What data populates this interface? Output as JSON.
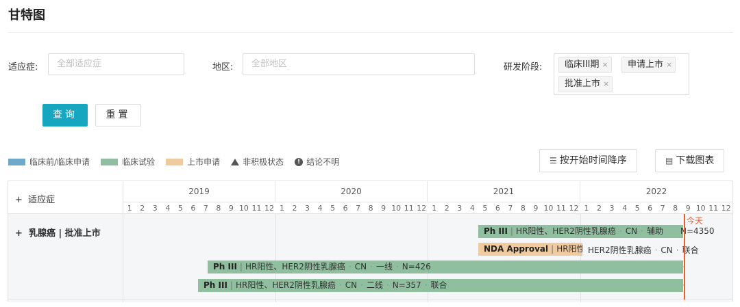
{
  "page": {
    "title": "甘特图"
  },
  "filters": {
    "indication": {
      "label": "适应症:",
      "placeholder": "全部适应症"
    },
    "region": {
      "label": "地区:",
      "placeholder": "全部地区"
    },
    "stage": {
      "label": "研发阶段:",
      "tags": [
        "临床III期",
        "申请上市",
        "批准上市"
      ],
      "remove_glyph": "×"
    }
  },
  "actions": {
    "search_label": "查询",
    "reset_label": "重置"
  },
  "legend": {
    "items": [
      {
        "label": "临床前/临床申请",
        "color": "#6fa8c8"
      },
      {
        "label": "临床试验",
        "color": "#8fbf9f"
      },
      {
        "label": "上市申请",
        "color": "#f0cba0"
      }
    ],
    "inactive_label": "非积极状态",
    "unclear_label": "结论不明"
  },
  "toolbar": {
    "sort_label": "按开始时间降序",
    "download_label": "下载图表"
  },
  "gantt": {
    "row_header_label": "适应症",
    "expand_glyph": "+",
    "years": [
      "2019",
      "2020",
      "2021",
      "2022"
    ],
    "months": [
      "1",
      "2",
      "3",
      "4",
      "5",
      "6",
      "7",
      "8",
      "9",
      "10",
      "11",
      "12"
    ],
    "group_label": "乳腺癌 | 批准上市",
    "today_label": "今天",
    "bars": [
      {
        "phase": "Ph III",
        "text": "HR阳性、HER2阴性乳腺癌",
        "region": "CN",
        "line": "辅助",
        "n": "N=4350",
        "type": "trial"
      },
      {
        "phase": "NDA Approval",
        "text": "HR阳性、HER2阴性乳腺癌",
        "region": "CN",
        "line": "联合",
        "type": "nda"
      },
      {
        "phase": "Ph III",
        "text": "HR阳性、HER2阴性乳腺癌",
        "region": "CN",
        "line": "一线",
        "n": "N=426",
        "type": "trial"
      },
      {
        "phase": "Ph III",
        "text": "HR阳性、HER2阴性乳腺癌",
        "region": "CN",
        "line": "二线",
        "n": "N=357",
        "extra": "联合",
        "type": "trial"
      }
    ]
  }
}
